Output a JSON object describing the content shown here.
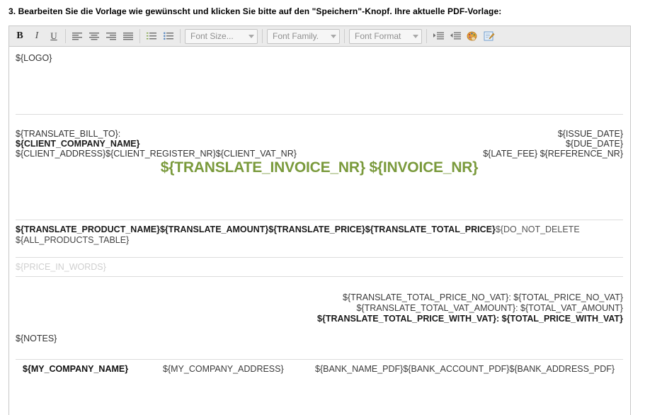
{
  "page": {
    "instruction": "3. Bearbeiten Sie die Vorlage wie gewünscht und klicken Sie bitte auf den \"Speichern\"-Knopf. Ihre aktuelle PDF-Vorlage:"
  },
  "toolbar": {
    "bold_label": "B",
    "italic_label": "I",
    "underline_label": "U",
    "align_left_name": "align-left",
    "align_center_name": "align-center",
    "align_right_name": "align-right",
    "align_justify_name": "align-justify",
    "ordered_list_name": "numbered-list",
    "unordered_list_name": "bullet-list",
    "font_size_label": "Font Size...",
    "font_family_label": "Font Family.",
    "font_format_label": "Font Format",
    "indent_label": "indent",
    "outdent_label": "outdent",
    "color_label": "text-color",
    "source_label": "edit-source"
  },
  "document": {
    "logo": "${LOGO}",
    "bill_to_label": "${TRANSLATE_BILL_TO}:",
    "client_company_name": "${CLIENT_COMPANY_NAME}",
    "client_details": "${CLIENT_ADDRESS}${CLIENT_REGISTER_NR}${CLIENT_VAT_NR}",
    "issue_date": "${ISSUE_DATE}",
    "due_date": "${DUE_DATE}",
    "late_fee_reference": "${LATE_FEE} ${REFERENCE_NR}",
    "invoice_title": "${TRANSLATE_INVOICE_NR} ${INVOICE_NR}",
    "invoice_title_color": "#7a9a3c",
    "products_header_bold": "${TRANSLATE_PRODUCT_NAME}${TRANSLATE_AMOUNT}${TRANSLATE_PRICE}${TRANSLATE_TOTAL_PRICE}",
    "products_header_plain": "${DO_NOT_DELETE",
    "all_products_table": "${ALL_PRODUCTS_TABLE}",
    "price_in_words": "${PRICE_IN_WORDS}",
    "total_price_no_vat": "${TRANSLATE_TOTAL_PRICE_NO_VAT}: ${TOTAL_PRICE_NO_VAT}",
    "total_vat_amount": "${TRANSLATE_TOTAL_VAT_AMOUNT}: ${TOTAL_VAT_AMOUNT}",
    "total_price_with_vat": "${TRANSLATE_TOTAL_PRICE_WITH_VAT}: ${TOTAL_PRICE_WITH_VAT}",
    "notes": "${NOTES}",
    "footer_company_name": "${MY_COMPANY_NAME}",
    "footer_company_address": "${MY_COMPANY_ADDRESS}",
    "footer_bank": "${BANK_NAME_PDF}${BANK_ACCOUNT_PDF}${BANK_ADDRESS_PDF}"
  }
}
